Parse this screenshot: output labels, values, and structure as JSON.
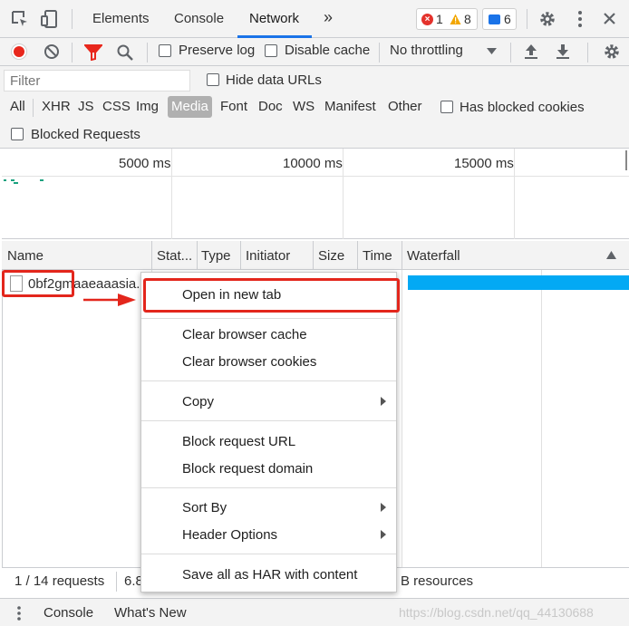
{
  "topbar": {
    "tabs": [
      "Elements",
      "Console",
      "Network"
    ],
    "active_tab": "Network",
    "more": "»",
    "errors": "1",
    "warnings": "8",
    "messages": "6"
  },
  "toolbar": {
    "preserve_log": "Preserve log",
    "disable_cache": "Disable cache",
    "throttling": "No throttling"
  },
  "filter": {
    "placeholder": "Filter",
    "hide_data_urls": "Hide data URLs",
    "types": [
      "All",
      "XHR",
      "JS",
      "CSS",
      "Img",
      "Media",
      "Font",
      "Doc",
      "WS",
      "Manifest",
      "Other"
    ],
    "active_type": "Media",
    "has_blocked_cookies": "Has blocked cookies",
    "blocked_requests": "Blocked Requests"
  },
  "overview": {
    "ticks": [
      "5000 ms",
      "10000 ms",
      "15000 ms"
    ]
  },
  "columns": [
    "Name",
    "Stat...",
    "Type",
    "Initiator",
    "Size",
    "Time",
    "Waterfall"
  ],
  "row": {
    "name": "0bf2gmaaeaaasia..."
  },
  "context_menu": {
    "open_new_tab": "Open in new tab",
    "clear_cache": "Clear browser cache",
    "clear_cookies": "Clear browser cookies",
    "copy": "Copy",
    "block_url": "Block request URL",
    "block_domain": "Block request domain",
    "sort_by": "Sort By",
    "header_options": "Header Options",
    "save_har": "Save all as HAR with content"
  },
  "status": {
    "requests": "1 / 14 requests",
    "transferred": "6.8",
    "resources": "B resources"
  },
  "drawer": {
    "tabs": [
      "Console",
      "What's New"
    ]
  },
  "watermark": "https://blog.csdn.net/qq_44130688",
  "colors": {
    "accent": "#1a73e8",
    "annotation_red": "#e3261c",
    "waterfall_bar": "#03a9f4"
  }
}
